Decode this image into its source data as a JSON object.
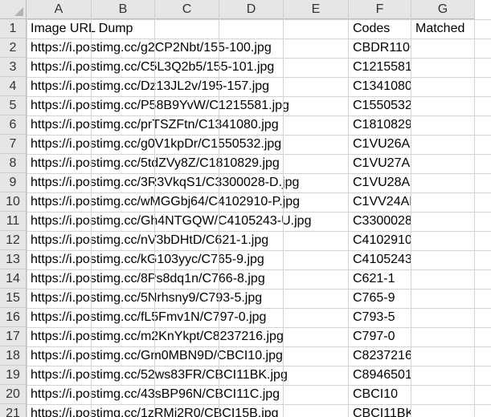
{
  "columns": [
    "A",
    "B",
    "C",
    "D",
    "E",
    "F",
    "G"
  ],
  "rows": [
    {
      "num": "1",
      "url": "Image URL Dump",
      "code": "Codes",
      "matched": "Matched"
    },
    {
      "num": "2",
      "url": "https://i.postimg.cc/g2CP2Nbt/155-100.jpg",
      "code": "CBDR110C",
      "matched": ""
    },
    {
      "num": "3",
      "url": "https://i.postimg.cc/C5L3Q2b5/155-101.jpg",
      "code": "C1215581",
      "matched": ""
    },
    {
      "num": "4",
      "url": "https://i.postimg.cc/Dz13JL2v/195-157.jpg",
      "code": "C1341080",
      "matched": ""
    },
    {
      "num": "5",
      "url": "https://i.postimg.cc/P58B9YvW/C1215581.jpg",
      "code": "C1550532",
      "matched": ""
    },
    {
      "num": "6",
      "url": "https://i.postimg.cc/prTSZFtn/C1341080.jpg",
      "code": "C1810829",
      "matched": ""
    },
    {
      "num": "7",
      "url": "https://i.postimg.cc/g0V1kpDr/C1550532.jpg",
      "code": "C1VU26AN",
      "matched": ""
    },
    {
      "num": "8",
      "url": "https://i.postimg.cc/5tdZVy8Z/C1810829.jpg",
      "code": "C1VU27AN",
      "matched": ""
    },
    {
      "num": "9",
      "url": "https://i.postimg.cc/3R3VkqS1/C3300028-D.jpg",
      "code": "C1VU28AN",
      "matched": ""
    },
    {
      "num": "10",
      "url": "https://i.postimg.cc/wMGGbj64/C4102910-P.jpg",
      "code": "C1VV24AN",
      "matched": ""
    },
    {
      "num": "11",
      "url": "https://i.postimg.cc/Gh4NTGQW/C4105243-U.jpg",
      "code": "C3300028D",
      "matched": ""
    },
    {
      "num": "12",
      "url": "https://i.postimg.cc/nV3bDHtD/C621-1.jpg",
      "code": "C4102910P",
      "matched": ""
    },
    {
      "num": "13",
      "url": "https://i.postimg.cc/kG103yyc/C765-9.jpg",
      "code": "C4105243U",
      "matched": ""
    },
    {
      "num": "14",
      "url": "https://i.postimg.cc/8Ps8dq1n/C766-8.jpg",
      "code": "C621-1",
      "matched": ""
    },
    {
      "num": "15",
      "url": "https://i.postimg.cc/5Nrhsny9/C793-5.jpg",
      "code": "C765-9",
      "matched": ""
    },
    {
      "num": "16",
      "url": "https://i.postimg.cc/fL5Fmv1N/C797-0.jpg",
      "code": "C793-5",
      "matched": ""
    },
    {
      "num": "17",
      "url": "https://i.postimg.cc/m2KnYkpt/C8237216.jpg",
      "code": "C797-0",
      "matched": ""
    },
    {
      "num": "18",
      "url": "https://i.postimg.cc/Gm0MBN9D/CBCI10.jpg",
      "code": "C8237216",
      "matched": ""
    },
    {
      "num": "19",
      "url": "https://i.postimg.cc/52ws83FR/CBCI11BK.jpg",
      "code": "C8946501",
      "matched": ""
    },
    {
      "num": "20",
      "url": "https://i.postimg.cc/43sBP96N/CBCI11C.jpg",
      "code": "CBCI10",
      "matched": ""
    },
    {
      "num": "21",
      "url": "https://i.postimg.cc/1zRMj2R0/CBCI15B.jpg",
      "code": "CBCI11BK",
      "matched": ""
    }
  ]
}
